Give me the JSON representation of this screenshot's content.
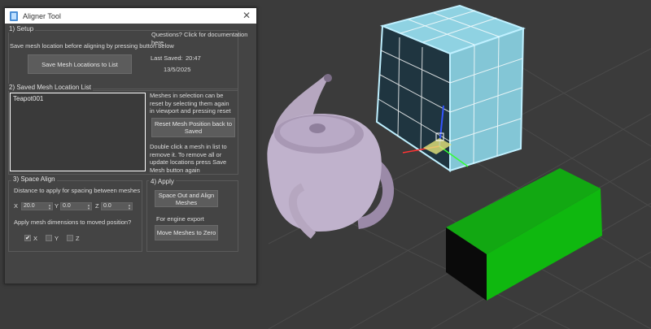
{
  "window": {
    "title": "Aligner Tool"
  },
  "setup": {
    "group_title": "1) Setup",
    "questions_link": "Questions? Click for documentation here",
    "instruction": "Save mesh location before aligning by pressing button below",
    "save_button": "Save Mesh Locations to List",
    "last_saved_label": "Last Saved:",
    "last_saved_time": "20:47",
    "last_saved_date": "13/5/2025"
  },
  "saved_list": {
    "group_title": "2) Saved Mesh Location List",
    "items": [
      "Teapot001"
    ],
    "reset_hint": "Meshes in selection can be reset by selecting them again in viewport and pressing reset",
    "reset_button": "Reset Mesh Position back to Saved",
    "remove_hint": "Double click a mesh in list to remove it. To remove all or update locations press Save Mesh button again"
  },
  "space_align": {
    "group_title": "3) Space Align",
    "distance_label": "Distance to apply for spacing between meshes",
    "x_label": "X",
    "x_value": "20.0",
    "y_label": "Y",
    "y_value": "0.0",
    "z_label": "Z",
    "z_value": "0.0",
    "dims_label": "Apply mesh dimensions to moved position?",
    "chk_x_label": "X",
    "chk_x_checked": true,
    "chk_y_label": "Y",
    "chk_y_checked": false,
    "chk_z_label": "Z",
    "chk_z_checked": false
  },
  "apply": {
    "group_title": "4) Apply",
    "space_button": "Space Out and Align Meshes",
    "engine_label": "For engine export",
    "zero_button": "Move Meshes to Zero"
  },
  "colors": {
    "viewport_bg": "#3a3a3a",
    "box_selected": "#86c8d8",
    "box_green": "#10b010"
  },
  "icons": {
    "check": "✔",
    "close": "✕"
  }
}
